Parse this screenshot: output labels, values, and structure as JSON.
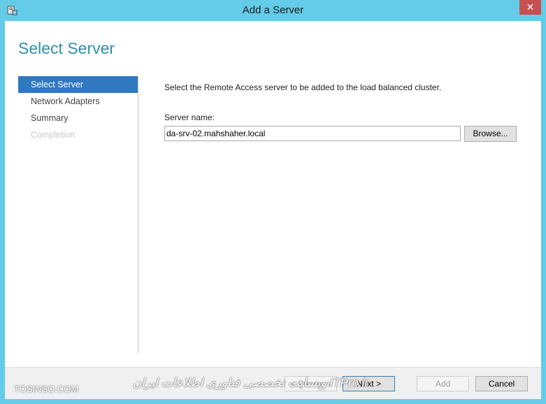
{
  "window": {
    "title": "Add a Server",
    "close_label": "✕"
  },
  "header": {
    "title": "Select Server"
  },
  "nav": {
    "items": [
      {
        "label": "Select Server",
        "state": "selected"
      },
      {
        "label": "Network Adapters",
        "state": "normal"
      },
      {
        "label": "Summary",
        "state": "normal"
      },
      {
        "label": "Completion",
        "state": "disabled"
      }
    ]
  },
  "content": {
    "description": "Select the Remote Access server to be added to the load balanced cluster.",
    "server_name_label": "Server name:",
    "server_name_value": "da-srv-02.mahshaher.local",
    "browse_label": "Browse..."
  },
  "footer": {
    "previous_label": "< Previous",
    "next_label": "Next >",
    "add_label": "Add",
    "cancel_label": "Cancel"
  },
  "watermarks": {
    "left": "TOSINSO.COM",
    "right": "وبسایت تخصصی فناوری اطلاعات ایران ITPro.ir"
  },
  "colors": {
    "titlebar": "#64cbe9",
    "accent": "#2e8fad",
    "selection": "#3078c0",
    "close": "#c75050"
  }
}
